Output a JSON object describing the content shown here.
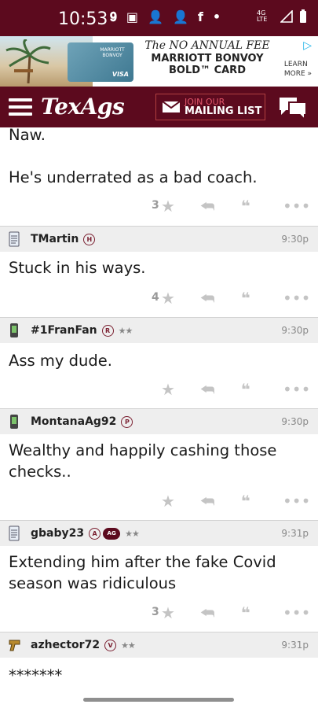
{
  "statusbar": {
    "time": "10:53",
    "network": "4G LTE"
  },
  "ad": {
    "headline_line1": "The NO ANNUAL FEE",
    "headline_line2": "MARRIOTT BONVOY",
    "headline_line3": "BOLD™ CARD",
    "cta_line1": "LEARN",
    "cta_line2": "MORE »",
    "card_brand": "MARRIOTT BONVOY",
    "card_network": "VISA"
  },
  "nav": {
    "logo": "TexAgs",
    "mail_line1": "JOIN OUR",
    "mail_line2": "MAILING LIST"
  },
  "posts": [
    {
      "body_line1": "Naw.",
      "body_line2": "He's underrated as a bad coach.",
      "likes": "3"
    },
    {
      "user": "TMartin",
      "badge": "H",
      "stars": "",
      "time": "9:30p",
      "body": "Stuck in his ways.",
      "likes": "4",
      "device": "notepad"
    },
    {
      "user": "#1FranFan",
      "badge": "R",
      "stars": "★★",
      "time": "9:30p",
      "body": "Ass my dude.",
      "likes": "",
      "device": "phone"
    },
    {
      "user": "MontanaAg92",
      "badge": "P",
      "stars": "",
      "time": "9:30p",
      "body": "Wealthy and happily cashing those checks..",
      "likes": "",
      "device": "phone"
    },
    {
      "user": "gbaby23",
      "badge": "A",
      "badge2": "AG",
      "stars": "★★",
      "time": "9:31p",
      "body": "Extending him after the fake Covid season was ridiculous",
      "likes": "3",
      "device": "notepad"
    },
    {
      "user": "azhector72",
      "badge": "V",
      "stars": "★★",
      "time": "9:31p",
      "body": "*******",
      "likes": "",
      "device": "gun"
    }
  ]
}
